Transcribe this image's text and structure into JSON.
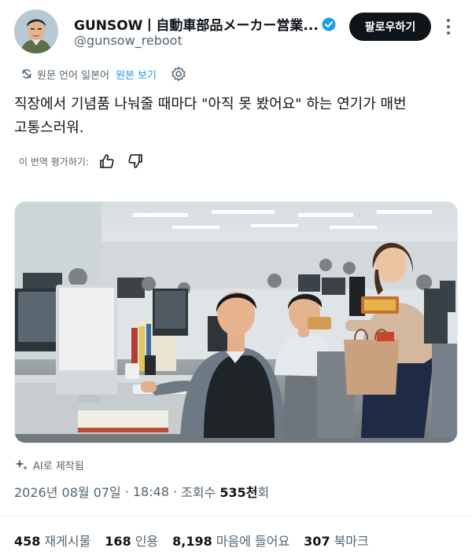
{
  "author": {
    "display_name": "GUNSOW丨自動車部品メーカー営業...",
    "handle": "@gunsow_reboot"
  },
  "follow_label": "팔로우하기",
  "translation": {
    "source_note": "원문 언어 일본어",
    "show_original": "원본 보기"
  },
  "tweet_text": "직장에서 기념품 나눠줄 때마다 \"아직 못 봤어요\" 하는 연기가 매번\n고통스러워.",
  "rate_label": "이 번역 평가하기:",
  "ai_label": "AI로 제작됨",
  "meta": {
    "date": "2026년 08월 07일",
    "time": "18:48",
    "views_prefix": "조회수",
    "views_value": "535천",
    "views_suffix": "회"
  },
  "stats": [
    {
      "value": "458",
      "label": "재게시물"
    },
    {
      "value": "168",
      "label": "인용"
    },
    {
      "value": "8,198",
      "label": "마음에 들어요"
    },
    {
      "value": "307",
      "label": "북마크"
    }
  ],
  "colors": {
    "accent": "#1d9bf0",
    "text": "#0f1419",
    "muted": "#536471",
    "follow_bg": "#0f1419"
  },
  "icons": {
    "translate": "translate-icon",
    "settings": "gear-icon",
    "thumb_up": "thumbs-up-icon",
    "thumb_down": "thumbs-down-icon",
    "ai": "sparkle-icon",
    "verified": "verified-badge-icon",
    "more": "more-options-icon"
  }
}
